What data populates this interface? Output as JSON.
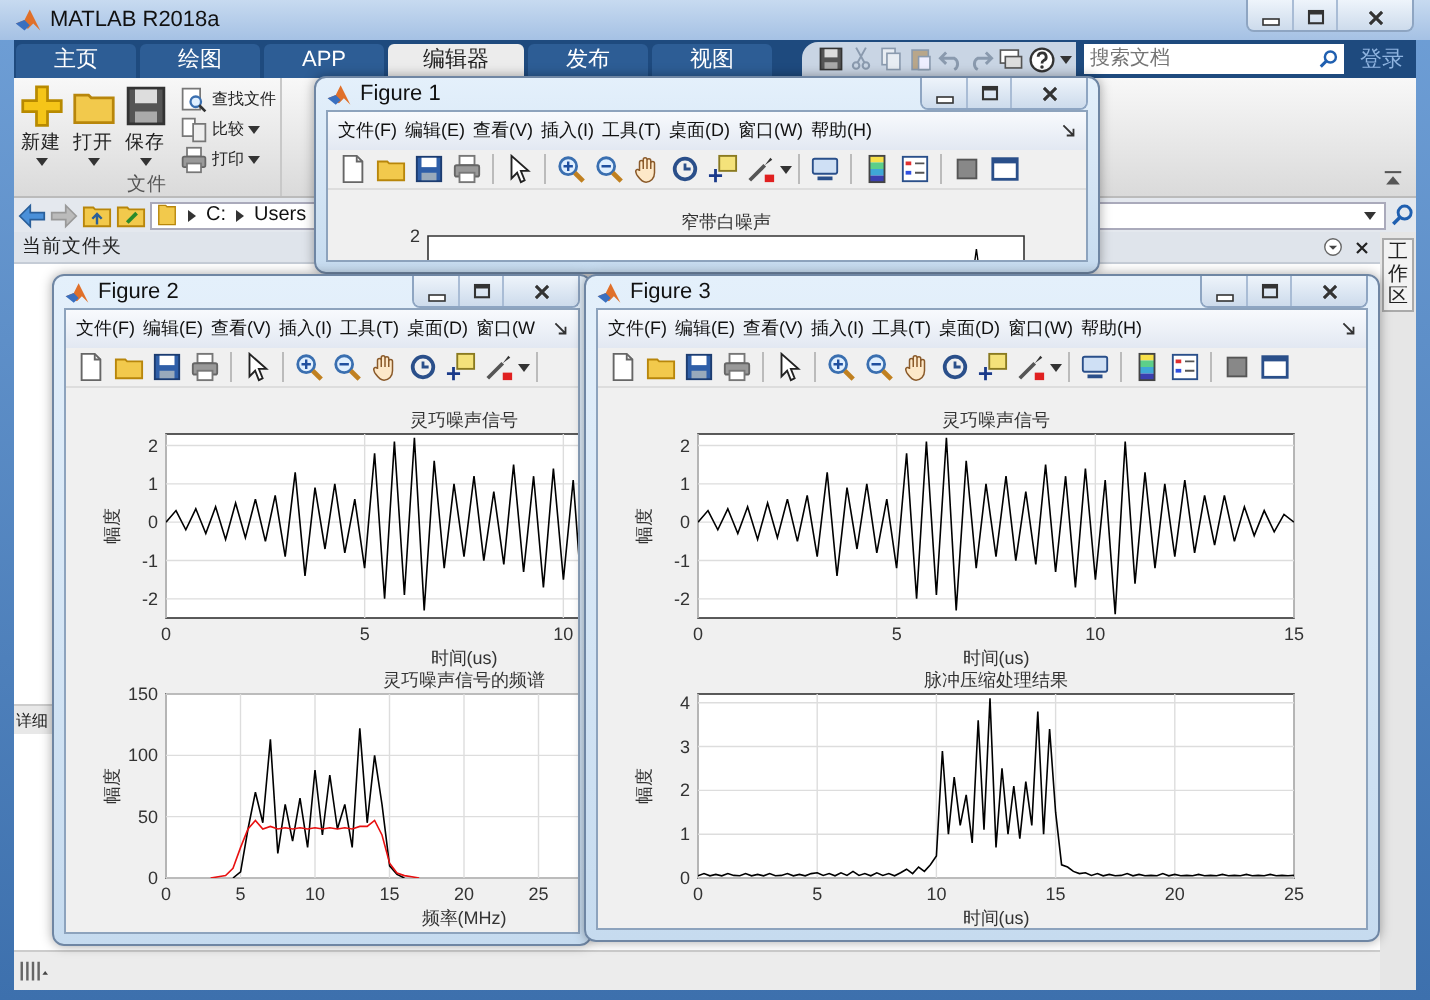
{
  "window": {
    "title": "MATLAB R2018a"
  },
  "tabs": [
    {
      "label": "主页",
      "selected": false
    },
    {
      "label": "绘图",
      "selected": false
    },
    {
      "label": "APP",
      "selected": false
    },
    {
      "label": "编辑器",
      "selected": true
    },
    {
      "label": "发布",
      "selected": false
    },
    {
      "label": "视图",
      "selected": false
    }
  ],
  "search": {
    "placeholder": "搜索文档"
  },
  "login": "登录",
  "ribbon": {
    "large_buttons": [
      {
        "label": "新建",
        "kind": "new",
        "dropdown": true
      },
      {
        "label": "打开",
        "kind": "open",
        "dropdown": true
      },
      {
        "label": "保存",
        "kind": "save",
        "dropdown": true
      }
    ],
    "small_buttons": [
      {
        "label": "查找文件",
        "kind": "find",
        "dropdown": false
      },
      {
        "label": "比较",
        "kind": "compare",
        "dropdown": true
      },
      {
        "label": "打印",
        "kind": "print",
        "dropdown": true
      }
    ],
    "section": "文件"
  },
  "address": {
    "path": [
      "C:",
      "Users"
    ]
  },
  "current_folder": {
    "title": "当前文件夹"
  },
  "details": {
    "title": "详细"
  },
  "workspace_tab": "工作区",
  "figures": [
    {
      "title": "Figure 1",
      "menus": [
        "文件(F)",
        "编辑(E)",
        "查看(V)",
        "插入(I)",
        "工具(T)",
        "桌面(D)",
        "窗口(W)",
        "帮助(H)"
      ],
      "axes": [
        {
          "title": "窄带白噪声",
          "yticks": [
            "2"
          ]
        }
      ]
    },
    {
      "title": "Figure 2",
      "menus": [
        "文件(F)",
        "编辑(E)",
        "查看(V)",
        "插入(I)",
        "工具(T)",
        "桌面(D)",
        "窗口(W"
      ],
      "axes": [
        {
          "chart_data": {
            "type": "line",
            "title": "灵巧噪声信号",
            "xlabel": "时间(us)",
            "ylabel": "幅度",
            "xlim": [
              0,
              15
            ],
            "ylim": [
              -2.5,
              2.3
            ],
            "xticks": [
              0,
              5,
              10
            ],
            "yticks": [
              2,
              1,
              0,
              -1,
              -2
            ],
            "grid": true,
            "x": [
              0,
              0.25,
              0.5,
              0.75,
              1,
              1.25,
              1.5,
              1.75,
              2,
              2.25,
              2.5,
              2.75,
              3,
              3.25,
              3.5,
              3.75,
              4,
              4.25,
              4.5,
              4.75,
              5,
              5.25,
              5.5,
              5.75,
              6,
              6.25,
              6.5,
              6.75,
              7,
              7.25,
              7.5,
              7.75,
              8,
              8.25,
              8.5,
              8.75,
              9,
              9.25,
              9.5,
              9.75,
              10,
              10.25,
              10.5
            ],
            "series": [
              {
                "color": "#000000",
                "values": [
                  0,
                  0.3,
                  -0.2,
                  0.35,
                  -0.3,
                  0.4,
                  -0.45,
                  0.5,
                  -0.4,
                  0.6,
                  -0.5,
                  0.7,
                  -0.9,
                  1.3,
                  -1.4,
                  0.9,
                  -0.7,
                  1.0,
                  -0.8,
                  0.6,
                  -1.2,
                  1.8,
                  -2.0,
                  2.1,
                  -1.9,
                  2.2,
                  -2.3,
                  1.6,
                  -1.2,
                  1.0,
                  -0.9,
                  1.2,
                  -1.0,
                  0.8,
                  -1.1,
                  1.5,
                  -1.3,
                  1.2,
                  -1.7,
                  1.4,
                  -1.5,
                  1.1,
                  -2.4
                ]
              }
            ]
          }
        },
        {
          "chart_data": {
            "type": "line",
            "title": "灵巧噪声信号的频谱",
            "xlabel": "频率(MHz)",
            "ylabel": "幅度",
            "xlim": [
              0,
              40
            ],
            "ylim": [
              0,
              150
            ],
            "xticks": [
              0,
              5,
              10,
              15,
              20,
              25
            ],
            "yticks": [
              150,
              100,
              50,
              0
            ],
            "grid": true,
            "x": [
              3,
              3.5,
              4,
              4.5,
              5,
              5.5,
              6,
              6.5,
              7,
              7.5,
              8,
              8.5,
              9,
              9.5,
              10,
              10.5,
              11,
              11.5,
              12,
              12.5,
              13,
              13.5,
              14,
              14.5,
              15,
              15.5,
              16,
              16.5,
              17
            ],
            "series": [
              {
                "color": "#000000",
                "values": [
                  null,
                  null,
                  null,
                  0,
                  5,
                  40,
                  70,
                  45,
                  113,
                  20,
                  60,
                  30,
                  65,
                  25,
                  88,
                  35,
                  84,
                  40,
                  60,
                  25,
                  122,
                  45,
                  100,
                  60,
                  10,
                  3,
                  0,
                  null,
                  null
                ]
              },
              {
                "color": "#e81010",
                "values": [
                  0,
                  1,
                  2,
                  8,
                  25,
                  40,
                  47,
                  40,
                  42,
                  40,
                  41,
                  40,
                  41,
                  40,
                  41,
                  40,
                  41,
                  40,
                  41,
                  40,
                  42,
                  42,
                  47,
                  35,
                  12,
                  4,
                  2,
                  1,
                  0
                ]
              }
            ]
          }
        }
      ]
    },
    {
      "title": "Figure 3",
      "menus": [
        "文件(F)",
        "编辑(E)",
        "查看(V)",
        "插入(I)",
        "工具(T)",
        "桌面(D)",
        "窗口(W)",
        "帮助(H)"
      ],
      "axes": [
        {
          "chart_data": {
            "type": "line",
            "title": "灵巧噪声信号",
            "xlabel": "时间(us)",
            "ylabel": "幅度",
            "xlim": [
              0,
              15
            ],
            "ylim": [
              -2.5,
              2.3
            ],
            "xticks": [
              0,
              5,
              10,
              15
            ],
            "yticks": [
              2,
              1,
              0,
              -1,
              -2
            ],
            "grid": true,
            "x": [
              0,
              0.25,
              0.5,
              0.75,
              1,
              1.25,
              1.5,
              1.75,
              2,
              2.25,
              2.5,
              2.75,
              3,
              3.25,
              3.5,
              3.75,
              4,
              4.25,
              4.5,
              4.75,
              5,
              5.25,
              5.5,
              5.75,
              6,
              6.25,
              6.5,
              6.75,
              7,
              7.25,
              7.5,
              7.75,
              8,
              8.25,
              8.5,
              8.75,
              9,
              9.25,
              9.5,
              9.75,
              10,
              10.25,
              10.5,
              10.75,
              11,
              11.25,
              11.5,
              11.75,
              12,
              12.25,
              12.5,
              12.75,
              13,
              13.25,
              13.5,
              13.75,
              14,
              14.25,
              14.5,
              14.75,
              15
            ],
            "series": [
              {
                "color": "#000000",
                "values": [
                  0,
                  0.3,
                  -0.2,
                  0.35,
                  -0.3,
                  0.4,
                  -0.45,
                  0.5,
                  -0.4,
                  0.6,
                  -0.5,
                  0.7,
                  -0.9,
                  1.3,
                  -1.4,
                  0.9,
                  -0.7,
                  1.0,
                  -0.8,
                  0.6,
                  -1.2,
                  1.8,
                  -2.0,
                  2.1,
                  -1.9,
                  2.2,
                  -2.3,
                  1.6,
                  -1.2,
                  1.0,
                  -0.9,
                  1.2,
                  -1.0,
                  0.8,
                  -1.1,
                  1.5,
                  -1.3,
                  1.2,
                  -1.7,
                  1.4,
                  -1.5,
                  1.1,
                  -2.4,
                  2.1,
                  -1.6,
                  1.3,
                  -1.2,
                  1.0,
                  -0.9,
                  1.1,
                  -0.8,
                  0.7,
                  -0.6,
                  0.7,
                  -0.5,
                  0.4,
                  -0.35,
                  0.3,
                  -0.25,
                  0.2,
                  0
                ]
              }
            ]
          }
        },
        {
          "chart_data": {
            "type": "line",
            "title": "脉冲压缩处理结果",
            "xlabel": "时间(us)",
            "ylabel": "幅度",
            "xlim": [
              0,
              25
            ],
            "ylim": [
              0,
              4.2
            ],
            "xticks": [
              0,
              5,
              10,
              15,
              20,
              25
            ],
            "yticks": [
              4,
              3,
              2,
              1,
              0
            ],
            "grid": true,
            "x": [
              0,
              0.25,
              0.5,
              0.75,
              1,
              1.25,
              1.5,
              1.75,
              2,
              2.25,
              2.5,
              2.75,
              3,
              3.25,
              3.5,
              3.75,
              4,
              4.25,
              4.5,
              4.75,
              5,
              5.25,
              5.5,
              5.75,
              6,
              6.25,
              6.5,
              6.75,
              7,
              7.25,
              7.5,
              7.75,
              8,
              8.25,
              8.5,
              8.75,
              9,
              9.25,
              9.5,
              9.75,
              10,
              10.25,
              10.5,
              10.75,
              11,
              11.25,
              11.5,
              11.75,
              12,
              12.25,
              12.5,
              12.75,
              13,
              13.25,
              13.5,
              13.75,
              14,
              14.25,
              14.5,
              14.75,
              15,
              15.25,
              15.5,
              15.75,
              16,
              16.25,
              16.5,
              16.75,
              17,
              17.25,
              17.5,
              17.75,
              18,
              18.25,
              18.5,
              18.75,
              19,
              19.25,
              19.5,
              19.75,
              20,
              20.25,
              20.5,
              20.75,
              21,
              21.25,
              21.5,
              21.75,
              22,
              22.25,
              22.5,
              22.75,
              23,
              23.25,
              23.5,
              23.75,
              24,
              24.25,
              24.5,
              24.75,
              25
            ],
            "series": [
              {
                "color": "#000000",
                "values": [
                  0.05,
                  0.1,
                  0.05,
                  0.08,
                  0.05,
                  0.1,
                  0.06,
                  0.05,
                  0.1,
                  0.05,
                  0.08,
                  0.05,
                  0.1,
                  0.05,
                  0.06,
                  0.1,
                  0.05,
                  0.08,
                  0.05,
                  0.1,
                  0.12,
                  0.06,
                  0.1,
                  0.05,
                  0.12,
                  0.06,
                  0.15,
                  0.06,
                  0.1,
                  0.05,
                  0.12,
                  0.06,
                  0.1,
                  0.05,
                  0.12,
                  0.2,
                  0.1,
                  0.25,
                  0.15,
                  0.3,
                  0.5,
                  2.9,
                  1.0,
                  2.3,
                  1.2,
                  1.9,
                  0.8,
                  3.6,
                  1.1,
                  4.1,
                  0.7,
                  2.5,
                  1.0,
                  2.1,
                  0.9,
                  2.2,
                  1.2,
                  3.8,
                  1.0,
                  3.4,
                  1.5,
                  0.3,
                  0.25,
                  0.15,
                  0.1,
                  0.12,
                  0.06,
                  0.1,
                  0.05,
                  0.08,
                  0.05,
                  0.06,
                  0.1,
                  0.05,
                  0.08,
                  0.05,
                  0.06,
                  0.05,
                  0.1,
                  0.05,
                  0.08,
                  0.05,
                  0.06,
                  0.05,
                  0.08,
                  0.05,
                  0.06,
                  0.05,
                  0.08,
                  0.05,
                  0.06,
                  0.05,
                  0.08,
                  0.05,
                  0.06,
                  0.05,
                  0.08,
                  0.05,
                  0.06,
                  0.05,
                  0.06
                ]
              }
            ]
          }
        }
      ]
    }
  ]
}
